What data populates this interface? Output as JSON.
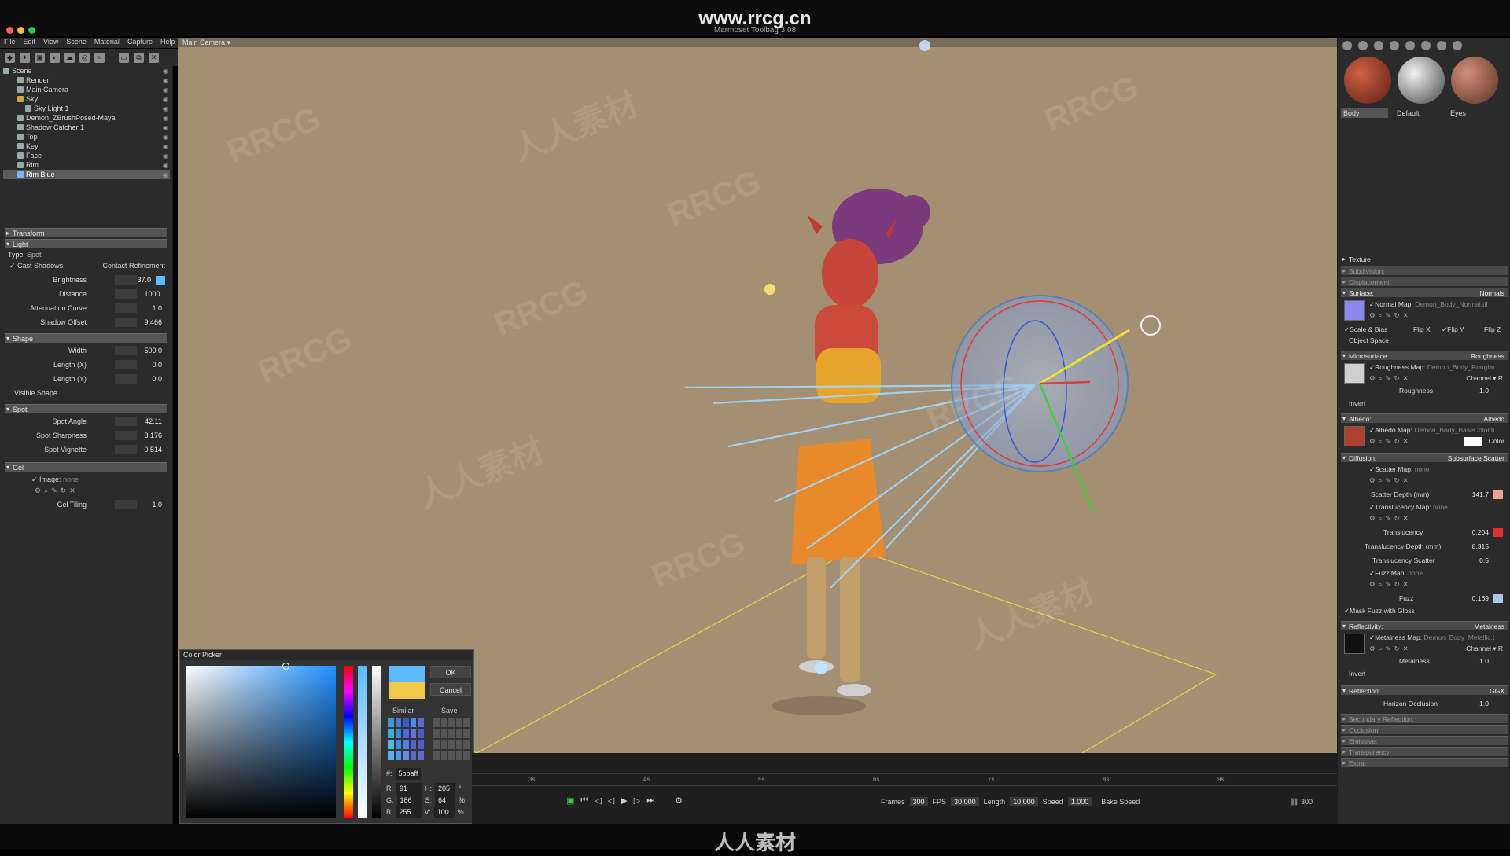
{
  "app": {
    "title": "Marmoset Toolbag 3.08",
    "site_watermark": "www.rrcg.cn",
    "bottom_logo": "人人素材",
    "watermark_text": "RRCG",
    "watermark_cn": "人人素材"
  },
  "menu": [
    "File",
    "Edit",
    "View",
    "Scene",
    "Material",
    "Capture",
    "Help"
  ],
  "viewport": {
    "camera": "Main Camera"
  },
  "outliner": {
    "items": [
      {
        "label": "Scene"
      },
      {
        "label": "Render"
      },
      {
        "label": "Main Camera"
      },
      {
        "label": "Sky"
      },
      {
        "label": "Sky Light 1"
      },
      {
        "label": "Demon_ZBrushPosed-Maya"
      },
      {
        "label": "Shadow Catcher 1"
      },
      {
        "label": "Top"
      },
      {
        "label": "Key"
      },
      {
        "label": "Face"
      },
      {
        "label": "Rim"
      },
      {
        "label": "Rim Blue"
      }
    ]
  },
  "left": {
    "transform": "Transform",
    "light": "Light",
    "type_label": "Type",
    "type_value": "Spot",
    "cast_shadows": "Cast Shadows",
    "contact_refinement": "Contact Refinement",
    "brightness_label": "Brightness",
    "brightness_value": "37.0",
    "brightness_color": "#5bbaff",
    "distance_label": "Distance",
    "distance_value": "1000.",
    "attenuation_label": "Attenuation Curve",
    "attenuation_value": "1.0",
    "shadow_offset_label": "Shadow Offset",
    "shadow_offset_value": "9.466",
    "shape": "Shape",
    "width_label": "Width",
    "width_value": "500.0",
    "lengthx_label": "Length (X)",
    "lengthx_value": "0.0",
    "lengthy_label": "Length (Y)",
    "lengthy_value": "0.0",
    "visible_shape": "Visible Shape",
    "spot": "Spot",
    "spot_angle_label": "Spot Angle",
    "spot_angle_value": "42.11",
    "spot_sharpness_label": "Spot Sharpness",
    "spot_sharpness_value": "8.176",
    "spot_vignette_label": "Spot Vignette",
    "spot_vignette_value": "0.514",
    "gel": "Gel",
    "image_label": "Image:",
    "image_value": "none",
    "gel_tiling_label": "Gel Tiling",
    "gel_tiling_value": "1.0"
  },
  "color_picker": {
    "title": "Color Picker",
    "ok": "OK",
    "cancel": "Cancel",
    "similar": "Similar",
    "save": "Save",
    "hex_label": "#:",
    "hex": "5bbaff",
    "r_label": "R:",
    "r": "91",
    "g_label": "G:",
    "g": "186",
    "b_label": "B:",
    "b": "255",
    "h_label": "H:",
    "h": "205",
    "s_label": "S:",
    "s": "64",
    "v_label": "V:",
    "v": "100",
    "deg": "°",
    "pct": "%",
    "color_new": "#5bbaff",
    "color_old": "#f2c84b"
  },
  "timeline": {
    "ticks": [
      "3s",
      "4s",
      "5s",
      "6s",
      "7s",
      "8s",
      "9s"
    ],
    "frames_label": "Frames",
    "frames": "300",
    "fps_label": "FPS",
    "fps": "30.000",
    "length_label": "Length",
    "length": "10.000",
    "speed_label": "Speed",
    "speed": "1.000",
    "bake_speed": "Bake Speed",
    "end_frame": "300"
  },
  "materials": [
    {
      "label": "Body",
      "color": "#8a3a2a"
    },
    {
      "label": "Default",
      "color": "#9a9a9a"
    },
    {
      "label": "Eyes",
      "color": "#a0604a"
    }
  ],
  "right": {
    "texture": "Texture",
    "subdivision": "Subdivision:",
    "displacement": "Displacement:",
    "surface": "Surface:",
    "surface_mode": "Normals",
    "normal_map_label": "Normal Map:",
    "normal_map": "Demon_Body_Normal.tif",
    "scale_bias": "Scale & Bias",
    "flip_x": "Flip X",
    "flip_y": "Flip Y",
    "flip_z": "Flip Z",
    "object_space": "Object Space",
    "microsurface": "Microsurface:",
    "microsurface_mode": "Roughness",
    "roughness_map_label": "Roughness Map:",
    "roughness_map": "Demon_Body_Roughn",
    "channel_label": "Channel",
    "channel_r": "R",
    "roughness_label": "Roughness",
    "roughness": "1.0",
    "invert": "Invert",
    "albedo": "Albedo:",
    "albedo_mode": "Albedo",
    "albedo_map_label": "Albedo Map:",
    "albedo_map": "Demon_Body_BaseColor.ti",
    "color_label": "Color",
    "diffusion": "Diffusion:",
    "diffusion_mode": "Subsurface Scatter",
    "scatter_map_label": "Scatter Map:",
    "scatter_map": "none",
    "scatter_depth_label": "Scatter Depth (mm)",
    "scatter_depth": "141.7",
    "translucency_map_label": "Translucency Map:",
    "translucency_map": "none",
    "translucency_label": "Translucency",
    "translucency": "0.204",
    "trans_depth_label": "Translucency Depth (mm)",
    "trans_depth": "8.315",
    "trans_scatter_label": "Translucency Scatter",
    "trans_scatter": "0.5",
    "fuzz_map_label": "Fuzz Map:",
    "fuzz_map": "none",
    "fuzz_label": "Fuzz",
    "fuzz": "0.169",
    "mask_fuzz": "Mask Fuzz with Gloss",
    "reflectivity": "Reflectivity:",
    "reflectivity_mode": "Metalness",
    "metalness_map_label": "Metalness Map:",
    "metalness_map": "Demon_Body_Metallic.t",
    "metalness_label": "Metalness",
    "metalness": "1.0",
    "reflection": "Reflection:",
    "reflection_mode": "GGX",
    "horizon_label": "Horizon Occlusion",
    "horizon": "1.0",
    "secondary_reflection": "Secondary Reflection:",
    "occlusion": "Occlusion:",
    "emissive": "Emissive:",
    "transparency": "Transparency:",
    "extra": "Extra:",
    "scatter_color": "#f0a090",
    "trans_color": "#e03030",
    "fuzz_color": "#a8c8f0",
    "albedo_color": "#ffffff"
  }
}
